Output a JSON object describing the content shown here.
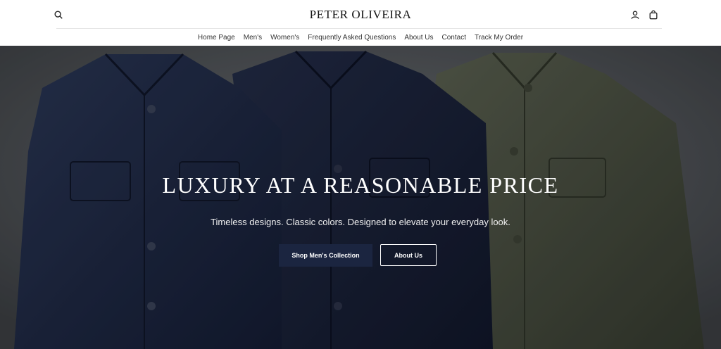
{
  "brand": {
    "logo_text": "PETER OLIVEIRA"
  },
  "header": {
    "icons": {
      "search": "search-icon",
      "account": "user-icon",
      "cart": "bag-icon"
    }
  },
  "nav": {
    "items": [
      {
        "label": "Home Page"
      },
      {
        "label": "Men's"
      },
      {
        "label": "Women's"
      },
      {
        "label": "Frequently Asked Questions"
      },
      {
        "label": "About Us"
      },
      {
        "label": "Contact"
      },
      {
        "label": "Track My Order"
      }
    ]
  },
  "hero": {
    "title": "LUXURY AT A REASONABLE PRICE",
    "subtitle": "Timeless designs. Classic colors. Designed to elevate your everyday look.",
    "primary_button": "Shop Men's Collection",
    "secondary_button": "About Us"
  },
  "colors": {
    "primary_button_bg": "#1b2540",
    "jacket_navy": "#1f2a45",
    "jacket_dark_navy": "#17203a",
    "jacket_olive": "#4a5041",
    "background_wall": "#5a5e62"
  }
}
